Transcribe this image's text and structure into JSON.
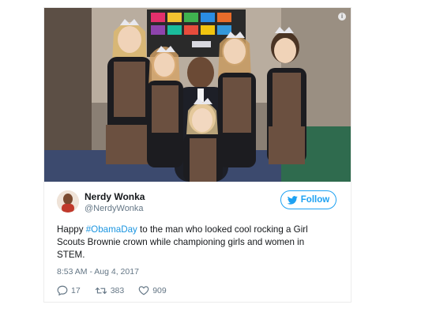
{
  "author": {
    "name": "Nerdy Wonka",
    "handle": "@NerdyWonka"
  },
  "follow_label": "Follow",
  "tweet": {
    "text_before": "Happy ",
    "hashtag": "#ObamaDay",
    "text_after": " to the man who looked cool rocking a Girl Scouts Brownie crown while championing girls and women in STEM."
  },
  "timestamp": "8:53 AM - Aug 4, 2017",
  "stats": {
    "replies": "17",
    "retweets": "383",
    "likes": "909"
  },
  "icons": {
    "info": "info-icon",
    "follow": "twitter-bird-icon",
    "reply": "reply-icon",
    "retweet": "retweet-icon",
    "like": "heart-icon"
  },
  "colors": {
    "accent": "#1da1f2",
    "hashtag": "#1b95e0",
    "secondary_text": "#657786"
  }
}
